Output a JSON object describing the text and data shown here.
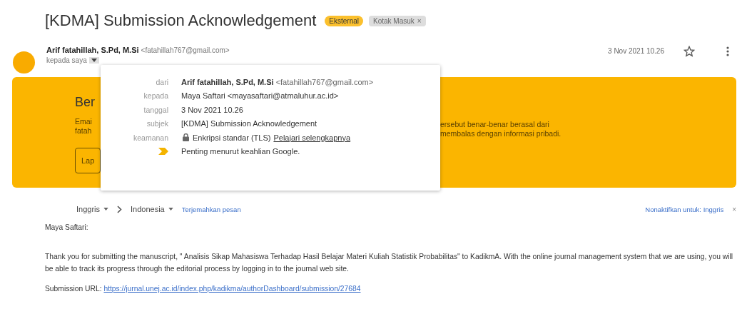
{
  "subject": "[KDMA] Submission Acknowledgement",
  "labels": [
    {
      "text": "Eksternal",
      "kind": "external"
    },
    {
      "text": "Kotak Masuk",
      "kind": "folder",
      "remove": "×"
    }
  ],
  "sender": {
    "name": "Arif fatahillah, S.Pd, M.Si",
    "email": "<fatahillah767@gmail.com>",
    "recipient": "kepada saya",
    "details_expanded": true
  },
  "date": "3 Nov 2021 10.26",
  "starred": false,
  "warning": {
    "title": "Ber",
    "left_lines": [
      "Emai",
      "fatah"
    ],
    "right_lines": [
      "ersebut benar-benar berasal dari",
      "membalas dengan informasi pribadi."
    ],
    "button": "Lap"
  },
  "details": [
    {
      "label": "dari",
      "kind": "sender",
      "name": "Arif fatahillah, S.Pd, M.Si",
      "value": "<fatahillah767@gmail.com>"
    },
    {
      "label": "kepada",
      "kind": "text",
      "value": "Maya Saftari <mayasaftari@atmaluhur.ac.id>"
    },
    {
      "label": "tanggal",
      "kind": "text",
      "value": "3 Nov 2021 10.26"
    },
    {
      "label": "subjek",
      "kind": "text",
      "value": "[KDMA] Submission Acknowledgement"
    },
    {
      "label": "keamanan",
      "kind": "security",
      "value": "Enkripsi standar (TLS)",
      "link": "Pelajari selengkapnya"
    },
    {
      "kind": "importance",
      "value": "Penting menurut keahlian Google."
    }
  ],
  "translate": {
    "from": "Inggris",
    "to": "Indonesia",
    "action": "Terjemahkan pesan",
    "disable": "Nonaktifkan untuk: Inggris",
    "close": "×"
  },
  "body": {
    "greeting": "Maya Saftari:",
    "paragraph": "Thank you for submitting the manuscript, \" Analisis Sikap Mahasiswa Terhadap Hasil Belajar Materi Kuliah Statistik Probabilitas\" to KadikmA. With the online journal management system that we are using, you will be able to track its progress through the editorial process by logging in to the journal web site.",
    "url_label": "Submission URL:",
    "url": "https://jurnal.unej.ac.id/index.php/kadikma/authorDashboard/submission/27684"
  }
}
